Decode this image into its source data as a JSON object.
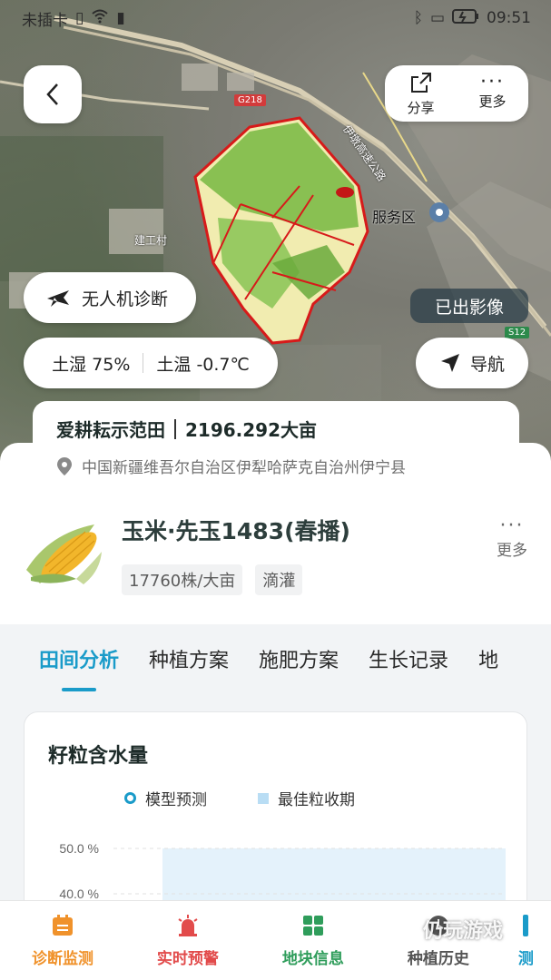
{
  "status_bar": {
    "carrier": "未插卡",
    "time": "09:51"
  },
  "map": {
    "labels": {
      "road_g218": "G218",
      "highway": "伊墩高速公路",
      "service_area": "服务区",
      "village": "建工村",
      "s12": "S12"
    },
    "imaged_badge": "已出影像"
  },
  "top_actions": {
    "share": "分享",
    "more": "更多"
  },
  "drone": {
    "label": "无人机诊断"
  },
  "soil": {
    "moisture": "土湿 75%",
    "temperature": "土温 -0.7℃"
  },
  "navigate": {
    "label": "导航"
  },
  "farm": {
    "name": "爱耕耘示范田",
    "area": "2196.292大亩",
    "address": "中国新疆维吾尔自治区伊犁哈萨克自治州伊宁县"
  },
  "crop": {
    "name": "玉米·先玉1483(春播)",
    "tags": [
      "17760株/大亩",
      "滴灌"
    ],
    "more_label": "更多"
  },
  "tabs": [
    "田间分析",
    "种植方案",
    "施肥方案",
    "生长记录",
    "地"
  ],
  "chart": {
    "title": "籽粒含水量"
  },
  "chart_data": {
    "type": "area",
    "title": "籽粒含水量",
    "legend": [
      "模型预测",
      "最佳粒收期"
    ],
    "y_ticks": [
      "50.0 %",
      "40.0 %"
    ],
    "ylim_visible": [
      40,
      50
    ],
    "series": [
      {
        "name": "最佳粒收期",
        "values": [
          50,
          50
        ]
      }
    ]
  },
  "bottom_nav": [
    {
      "label": "诊断监测",
      "icon": "calendar-icon",
      "color": "#f0922b"
    },
    {
      "label": "实时预警",
      "icon": "siren-icon",
      "color": "#e24b4b"
    },
    {
      "label": "地块信息",
      "icon": "grid-icon",
      "color": "#2f9d5b"
    },
    {
      "label": "种植历史",
      "icon": "history-icon",
      "color": "#555555"
    },
    {
      "label": "测",
      "icon": "measure-icon",
      "color": "#1a9bc9"
    }
  ],
  "watermark": "仍玩游戏",
  "colors": {
    "accent": "#1a9bc9"
  }
}
